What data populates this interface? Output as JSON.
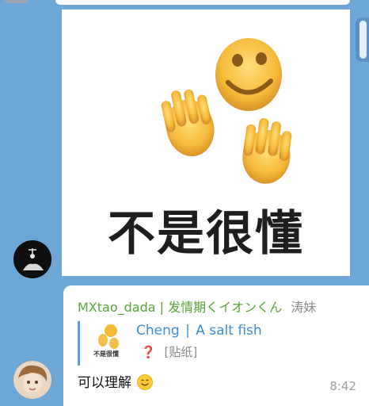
{
  "sticker": {
    "caption": "不是很懂",
    "icon": "smiley-hands-sticker"
  },
  "message": {
    "sender": "MXtao_dada",
    "sender_separator": "|",
    "sender_suffix": "发情期くイオンくん",
    "sender_extra": "涛妹",
    "reply": {
      "thumb_text": "不是很懂",
      "name": "Cheng",
      "name_separator": "|",
      "name_suffix": "A salt fish",
      "preview_icon": "❓",
      "preview_text": "[贴纸]"
    },
    "text": "可以理解",
    "emoji": "smiling-face-emoji",
    "time": "8:42"
  },
  "colors": {
    "background": "#6ea6d6",
    "sender": "#5aa33b",
    "reply_accent": "#3f8dd0",
    "timestamp": "#a0a0a0"
  }
}
